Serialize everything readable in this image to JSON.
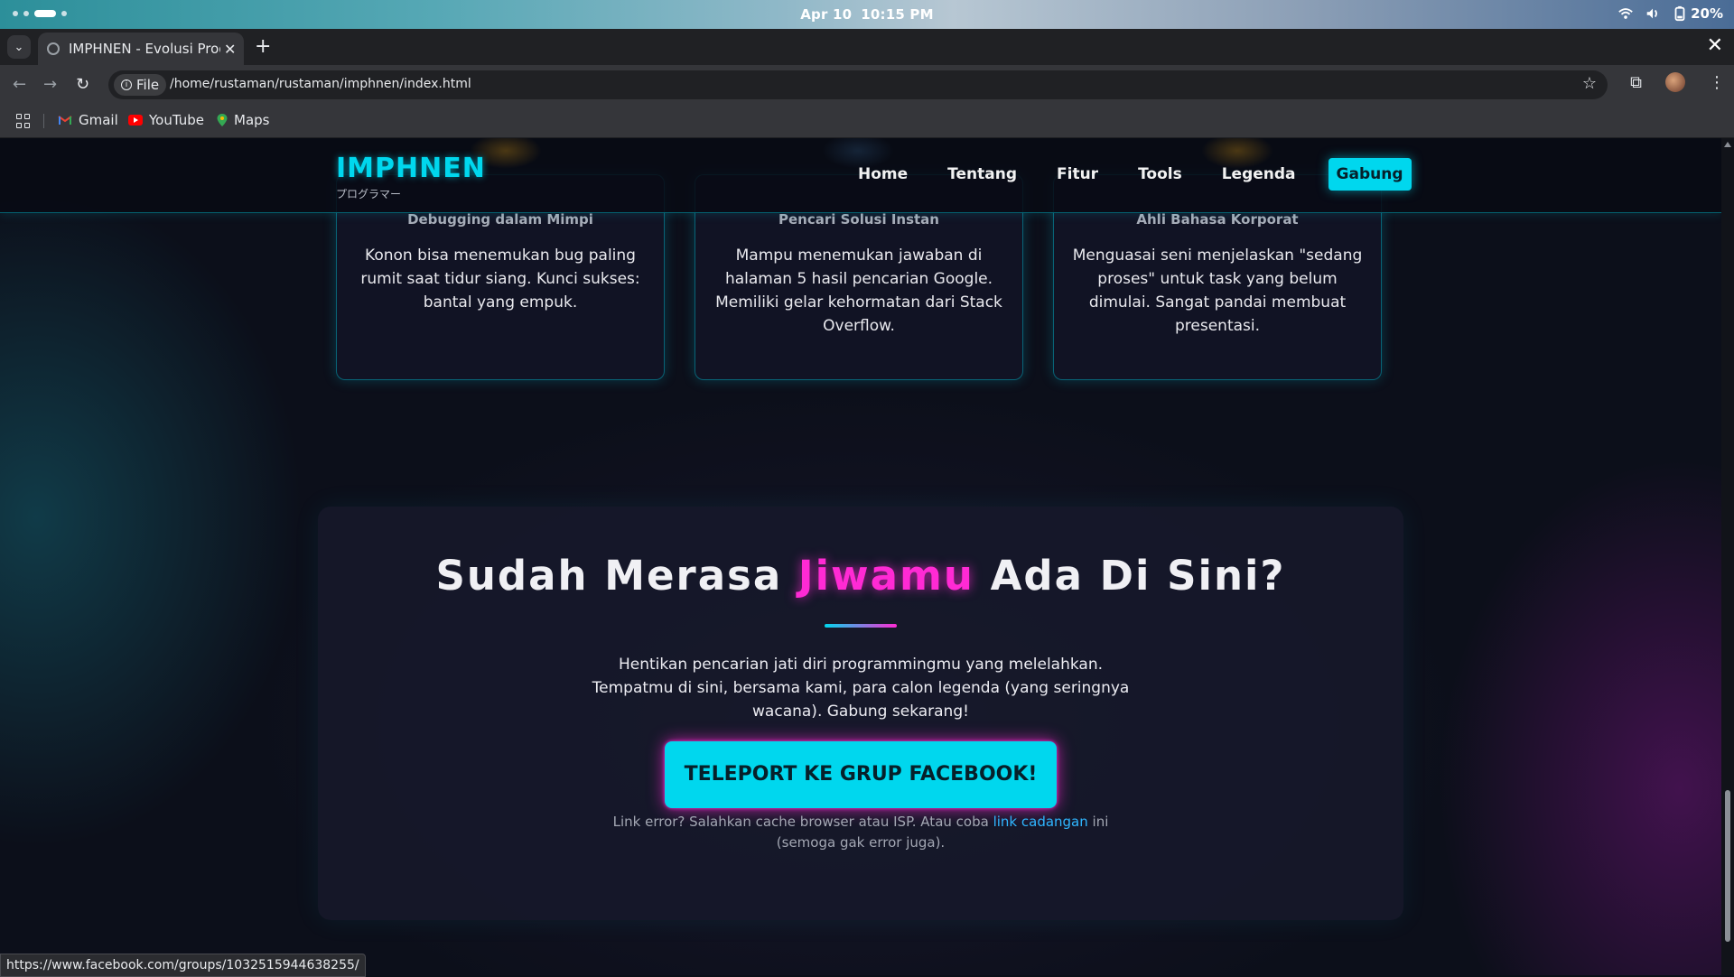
{
  "os": {
    "date": "Apr 10",
    "time": "10:15 PM",
    "battery": "20%"
  },
  "browser": {
    "tab_title": "IMPHNEN - Evolusi Prog",
    "omnibox_chip": "File",
    "url": "/home/rustaman/rustaman/imphnen/index.html",
    "bookmarks": [
      "Gmail",
      "YouTube",
      "Maps"
    ],
    "status_url": "https://www.facebook.com/groups/1032515944638255/"
  },
  "header": {
    "logo": "IMPHNEN",
    "logo_sub": "プログラマー",
    "nav": [
      "Home",
      "Tentang",
      "Fitur",
      "Tools",
      "Legenda"
    ],
    "cta": "Gabung"
  },
  "cards": [
    {
      "subtitle": "Debugging dalam Mimpi",
      "description": "Konon bisa menemukan bug paling rumit saat tidur siang. Kunci sukses: bantal yang empuk."
    },
    {
      "subtitle": "Pencari Solusi Instan",
      "description": "Mampu menemukan jawaban di halaman 5 hasil pencarian Google. Memiliki gelar kehormatan dari Stack Overflow."
    },
    {
      "subtitle": "Ahli Bahasa Korporat",
      "description": "Menguasai seni menjelaskan \"sedang proses\" untuk task yang belum dimulai. Sangat pandai membuat presentasi."
    }
  ],
  "cta_section": {
    "title_before": "Sudah Merasa",
    "title_highlight": "Jiwamu",
    "title_after": "Ada Di Sini?",
    "text": "Hentikan pencarian jati diri programmingmu yang melelahkan. Tempatmu di sini, bersama kami, para calon legenda (yang seringnya wacana). Gabung sekarang!",
    "button": "TELEPORT KE GRUP FACEBOOK!",
    "note_before": "Link error? Salahkan cache browser atau ISP. Atau coba",
    "note_link": "link cadangan",
    "note_after": "ini (semoga gak error juga)."
  },
  "colors": {
    "accent_cyan": "#00d7ee",
    "accent_magenta": "#ff2ad4",
    "link_blue": "#2fb6ff"
  }
}
